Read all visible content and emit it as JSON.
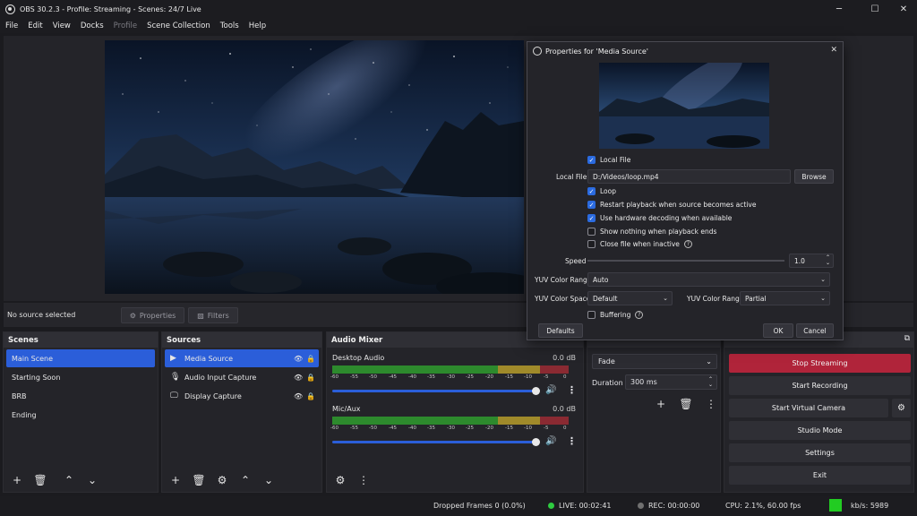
{
  "window": {
    "title": "OBS 30.2.3 - Profile: Streaming - Scenes: 24/7 Live",
    "minimize": "─",
    "maximize": "☐",
    "close": "✕"
  },
  "menu": [
    {
      "label": "File"
    },
    {
      "label": "Edit"
    },
    {
      "label": "View"
    },
    {
      "label": "Docks"
    },
    {
      "label": "Profile",
      "disabled": true
    },
    {
      "label": "Scene Collection"
    },
    {
      "label": "Tools"
    },
    {
      "label": "Help"
    }
  ],
  "context_bar": {
    "status": "No source selected",
    "properties_label": "Properties",
    "filters_label": "Filters"
  },
  "scenes": {
    "title": "Scenes",
    "items": [
      "Main Scene",
      "Starting Soon",
      "BRB",
      "Ending"
    ],
    "selected": 0
  },
  "sources": {
    "title": "Sources",
    "items": [
      "Media Source",
      "Audio Input Capture",
      "Display Capture"
    ],
    "selected": 0
  },
  "audio_mixer": {
    "title": "Audio Mixer",
    "scale": [
      "-60",
      "-55",
      "-50",
      "-45",
      "-40",
      "-35",
      "-30",
      "-25",
      "-20",
      "-15",
      "-10",
      "-5",
      "0"
    ],
    "channels": [
      {
        "name": "Desktop Audio",
        "db": "0.0 dB",
        "volume": 0.95
      },
      {
        "name": "Mic/Aux",
        "db": "0.0 dB",
        "volume": 0.95
      }
    ]
  },
  "transitions": {
    "type": "Fade",
    "duration_label": "Duration",
    "duration_value": "300 ms"
  },
  "controls": {
    "stop_streaming": "Stop Streaming",
    "start_recording": "Start Recording",
    "start_virtual_camera": "Start Virtual Camera",
    "studio_mode": "Studio Mode",
    "settings": "Settings",
    "exit": "Exit"
  },
  "status_bar": {
    "dropped_frames": "Dropped Frames 0 (0.0%)",
    "live": "LIVE: 00:02:41",
    "rec": "REC: 00:00:00",
    "cpu": "CPU: 2.1%, 60.00 fps",
    "kbps": "kb/s: 5989"
  },
  "properties_dialog": {
    "title": "Properties for 'Media Source'",
    "local_file_check": "Local File",
    "local_file_label": "Local File",
    "local_file_value": "D:/Videos/loop.mp4",
    "browse": "Browse",
    "options": [
      {
        "label": "Loop",
        "checked": true
      },
      {
        "label": "Restart playback when source becomes active",
        "checked": true
      },
      {
        "label": "Use hardware decoding when available",
        "checked": true
      },
      {
        "label": "Show nothing when playback ends",
        "checked": false
      },
      {
        "label": "Close file when inactive",
        "checked": false
      }
    ],
    "speed_label": "Speed",
    "speed_value": "1.0",
    "yuv_range_label": "YUV Color Range",
    "yuv_range_value": "Auto",
    "yuv_space_label": "YUV Color Space",
    "yuv_space_value": "Default",
    "yuv_color_range_label": "YUV Color Range",
    "yuv_color_range_value": "Partial",
    "buffering_label": "Buffering",
    "defaults": "Defaults",
    "ok": "OK",
    "cancel": "Cancel"
  },
  "colors": {
    "accent": "#2b5ed9",
    "stop_streaming": "#b0243a",
    "live_dot": "#2ecc40",
    "rec_dot": "#707070",
    "health": "#22cc22"
  }
}
